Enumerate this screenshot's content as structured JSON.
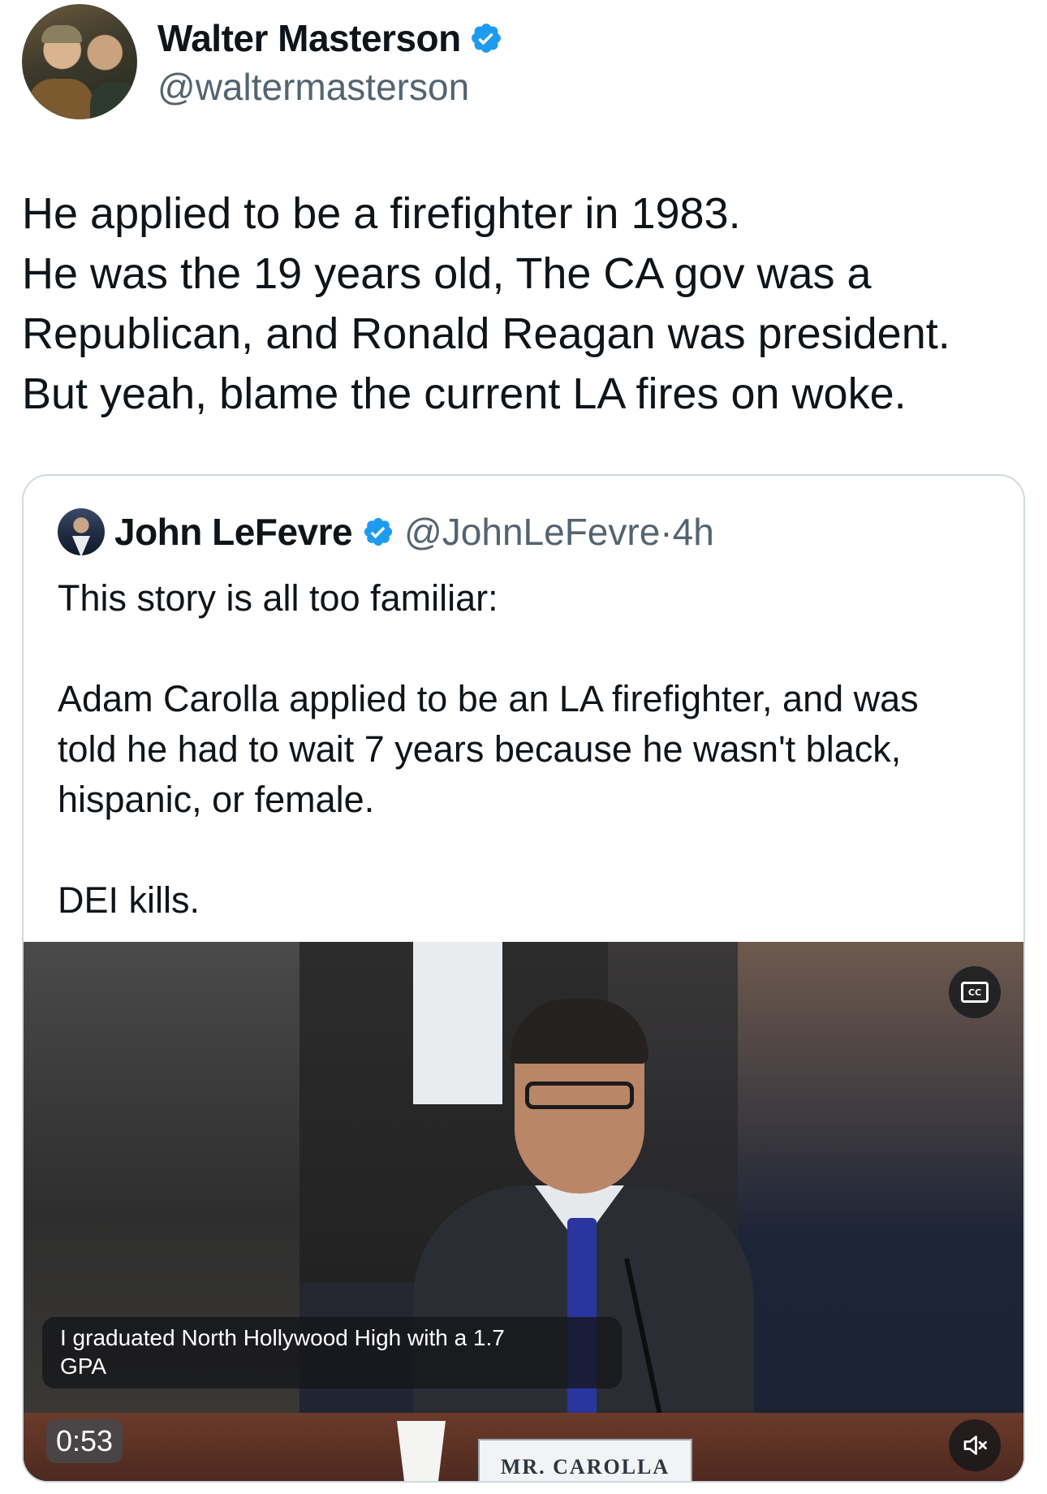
{
  "author": {
    "display_name": "Walter Masterson",
    "handle": "@waltermasterson",
    "verified": true,
    "avatar_icon": "profile-photo"
  },
  "tweet": {
    "lines": [
      "He applied to be a firefighter in 1983.",
      "He was the 19 years old, The CA gov was a",
      "Republican, and Ronald Reagan was president.",
      "But yeah, blame the current LA fires on woke."
    ]
  },
  "quoted_tweet": {
    "display_name": "John LeFevre",
    "handle": "@JohnLeFevre",
    "separator": "·",
    "time": "4h",
    "verified": true,
    "paragraph_1": "This story is all too familiar:",
    "paragraph_2_lines": [
      "Adam Carolla applied to be an LA firefighter, and was",
      "told he had to wait 7 years because he wasn't black,",
      "hispanic, or female."
    ],
    "paragraph_3": "DEI kills."
  },
  "video": {
    "caption_lines": [
      "I graduated North Hollywood High with a 1.7",
      "GPA"
    ],
    "timestamp": "0:53",
    "nameplate": "MR. CAROLLA",
    "cc_label": "CC",
    "cc_icon": "closed-captions-icon",
    "mute_icon": "muted-speaker-icon"
  },
  "colors": {
    "verified_blue": "#1d9bf0",
    "secondary_text": "#536471",
    "primary_text": "#0f1419",
    "border": "#cfd9de"
  }
}
